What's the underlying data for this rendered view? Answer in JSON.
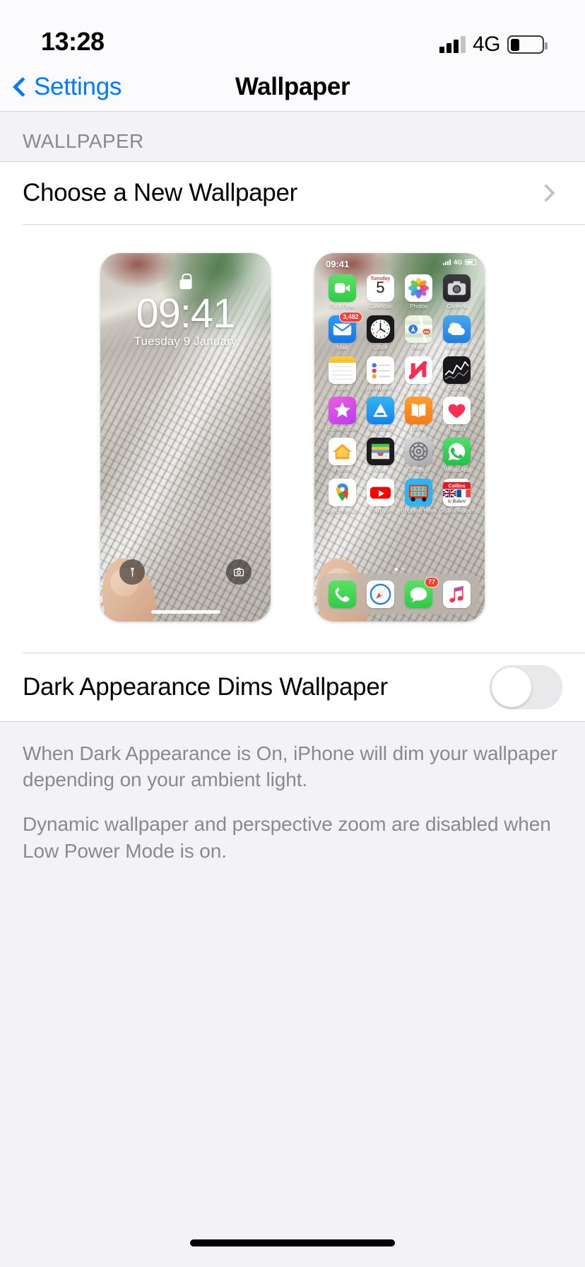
{
  "status_bar": {
    "time": "13:28",
    "network": "4G",
    "battery_level": 30,
    "signal_icon": "signal-bars-icon",
    "battery_icon": "battery-icon"
  },
  "nav": {
    "back_label": "Settings",
    "back_icon": "chevron-left-icon",
    "title": "Wallpaper"
  },
  "section": {
    "header": "WALLPAPER"
  },
  "rows": {
    "choose_wallpaper": {
      "label": "Choose a New Wallpaper",
      "disclosure_icon": "chevron-right-icon"
    },
    "dark_dims": {
      "label": "Dark Appearance Dims Wallpaper",
      "toggle_state": "off"
    }
  },
  "previews": {
    "lock_screen": {
      "name": "lock-screen-preview",
      "lock_icon": "lock-icon",
      "time": "09:41",
      "date": "Tuesday 9 January",
      "torch_icon": "torch-icon",
      "camera_icon": "camera-icon"
    },
    "home_screen": {
      "name": "home-screen-preview",
      "status_time": "09:41",
      "status_network": "4G",
      "page_dots": 2,
      "active_dot": 0,
      "apps": [
        {
          "label": "FaceTime",
          "icon": "facetime-icon",
          "badge": null
        },
        {
          "label": "Calendar",
          "icon": "calendar-icon",
          "badge": null,
          "cal_weekday": "Tuesday",
          "cal_day": "5"
        },
        {
          "label": "Photos",
          "icon": "photos-icon",
          "badge": null
        },
        {
          "label": "Camera",
          "icon": "camera-app-icon",
          "badge": null
        },
        {
          "label": "Mail",
          "icon": "mail-icon",
          "badge": "3,482"
        },
        {
          "label": "Clock",
          "icon": "clock-icon",
          "badge": null
        },
        {
          "label": "Maps",
          "icon": "maps-icon",
          "badge": null
        },
        {
          "label": "Weather",
          "icon": "weather-icon",
          "badge": null
        },
        {
          "label": "Notes",
          "icon": "notes-icon",
          "badge": null
        },
        {
          "label": "Reminders",
          "icon": "reminders-icon",
          "badge": null
        },
        {
          "label": "News",
          "icon": "news-icon",
          "badge": null
        },
        {
          "label": "Stocks",
          "icon": "stocks-icon",
          "badge": null
        },
        {
          "label": "iTunes Store",
          "icon": "itunes-store-icon",
          "badge": null
        },
        {
          "label": "App Store",
          "icon": "app-store-icon",
          "badge": null
        },
        {
          "label": "Books",
          "icon": "books-icon",
          "badge": null
        },
        {
          "label": "Health",
          "icon": "health-icon",
          "badge": null
        },
        {
          "label": "Home",
          "icon": "home-icon",
          "badge": null
        },
        {
          "label": "Wallet",
          "icon": "wallet-icon",
          "badge": null
        },
        {
          "label": "Settings",
          "icon": "settings-icon",
          "badge": null
        },
        {
          "label": "WhatsApp",
          "icon": "whatsapp-icon",
          "badge": null
        },
        {
          "label": "Google Maps",
          "icon": "google-maps-icon",
          "badge": null
        },
        {
          "label": "YouTube",
          "icon": "youtube-icon",
          "badge": null
        },
        {
          "label": "Brighton Hove",
          "icon": "brighton-hove-bus-icon",
          "badge": null
        },
        {
          "label": "Collins-Robert",
          "icon": "collins-robert-icon",
          "badge": null
        }
      ],
      "dock": [
        {
          "label": "Phone",
          "icon": "phone-icon",
          "badge": null
        },
        {
          "label": "Safari",
          "icon": "safari-icon",
          "badge": null
        },
        {
          "label": "Messages",
          "icon": "messages-icon",
          "badge": "77"
        },
        {
          "label": "Music",
          "icon": "music-icon",
          "badge": null
        }
      ]
    }
  },
  "footer": {
    "line1": "When Dark Appearance is On, iPhone will dim your wallpaper depending on your ambient light.",
    "line2": "Dynamic wallpaper and perspective zoom are disabled when Low Power Mode is on."
  },
  "colors": {
    "accent": "#007aff",
    "badge_red": "#ff3b30",
    "group_bg": "#f2f2f7",
    "card_bg": "#ffffff",
    "secondary_text": "#8a8a8e"
  }
}
